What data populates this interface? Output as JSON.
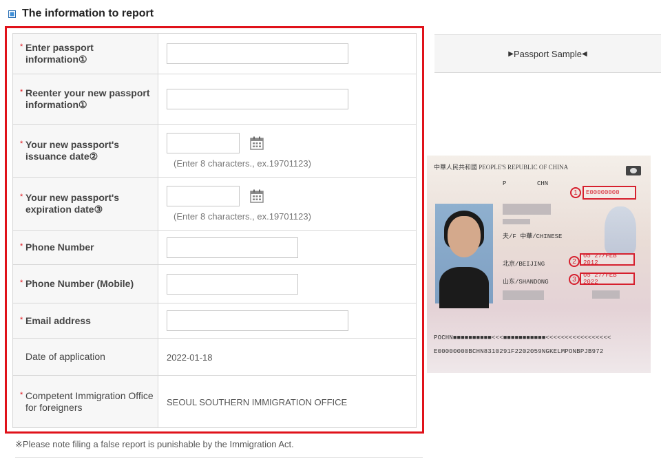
{
  "section": {
    "title": "The information to report"
  },
  "form": {
    "required_mark": "*",
    "passport_info_label": "Enter passport information①",
    "passport_info_value": "",
    "reenter_label": "Reenter your new passport information①",
    "reenter_value": "",
    "issuance_label": "Your new passport's issuance date②",
    "issuance_value": "",
    "issuance_hint": "(Enter 8 characters., ex.19701123)",
    "expiration_label": "Your new passport's expiration date③",
    "expiration_value": "",
    "expiration_hint": "(Enter 8 characters., ex.19701123)",
    "phone_label": "Phone Number",
    "phone_value": "",
    "mobile_label": "Phone Number (Mobile)",
    "mobile_value": "",
    "email_label": "Email address",
    "email_value": "",
    "date_label": "Date of application",
    "date_value": "2022-01-18",
    "office_label": "Competent Immigration Office for foreigners",
    "office_value": "SEOUL SOUTHERN IMMIGRATION OFFICE"
  },
  "note": "※Please note filing a false report is punishable by the Immigration Act.",
  "sample": {
    "label": "Passport Sample",
    "arrow_left": "▶",
    "arrow_right": "◀",
    "header_text": "中華人民共和國  PEOPLE'S REPUBLIC OF CHINA",
    "type": "P",
    "country": "CHN",
    "passport_no": "E00000000",
    "name_line": "夫/F  中華/CHINESE",
    "issue_date": "05 27/FEB 2012",
    "expiry_date": "05 27/FEB 2022",
    "place_birth": "北京/BEIJING",
    "place_issue": "山东/SHANDONG",
    "mrz1": "POCHN■■■■■■■■■■<<<■■■■■■■■■■■<<<<<<<<<<<<<<<<<",
    "mrz2": "E00000000BCHN8310291F2202059NGKELMPONBPJB972",
    "circle_1": "1",
    "circle_2": "2",
    "circle_3": "3"
  },
  "colors": {
    "accent": "#e0121a",
    "header_icon": "#3f8fd8"
  },
  "icons": [
    "square-bullet-icon",
    "calendar-icon"
  ]
}
